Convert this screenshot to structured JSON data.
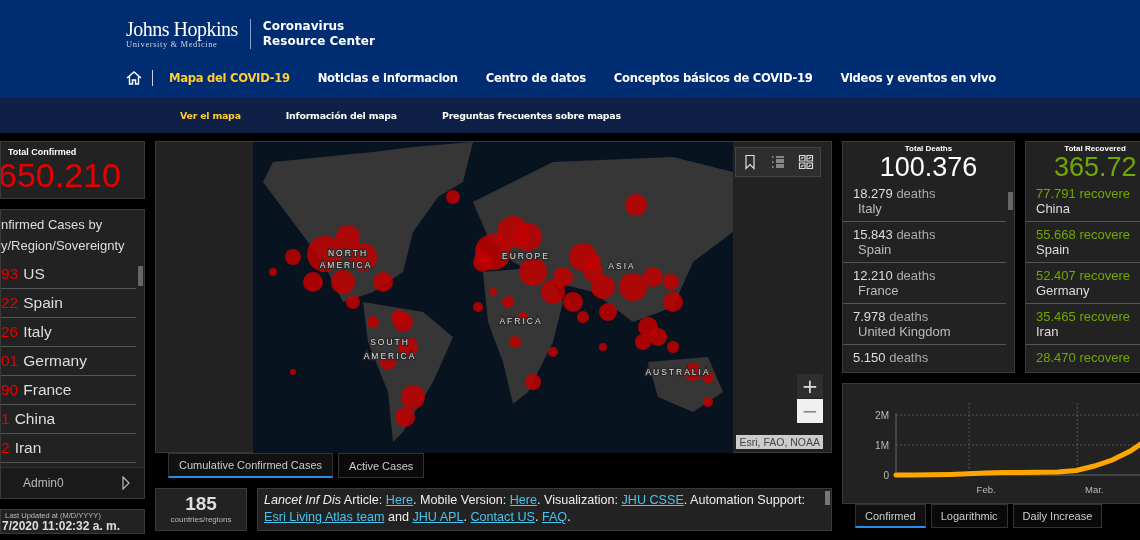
{
  "header": {
    "logo_name": "Johns Hopkins",
    "logo_sub": "University & Medicine",
    "site_title": [
      "Coronavirus",
      "Resource Center"
    ],
    "nav": [
      {
        "label": "Mapa del COVID-19",
        "selected": true
      },
      {
        "label": "Noticias e informacion",
        "selected": false
      },
      {
        "label": "Centro de datos",
        "selected": false
      },
      {
        "label": "Conceptos básicos de COVID-19",
        "selected": false
      },
      {
        "label": "Videos y eventos en vivo",
        "selected": false
      }
    ],
    "subnav": [
      {
        "label": "Ver el mapa",
        "selected": true
      },
      {
        "label": "Información del mapa",
        "selected": false
      },
      {
        "label": "Preguntas frecuentes sobre mapas",
        "selected": false
      }
    ]
  },
  "total_confirmed": {
    "label": "Total Confirmed",
    "value": "650.210"
  },
  "confirmed_list": {
    "title": [
      "nfirmed Cases by",
      "y/Region/Sovereignty"
    ],
    "rows": [
      {
        "count": "93",
        "name": "US"
      },
      {
        "count": "22",
        "name": "Spain"
      },
      {
        "count": "26",
        "name": "Italy"
      },
      {
        "count": "01",
        "name": "Germany"
      },
      {
        "count": "90",
        "name": "France"
      },
      {
        "count": "1",
        "name": "China"
      },
      {
        "count": "2",
        "name": "Iran"
      }
    ],
    "footer": "Admin0"
  },
  "last_updated": {
    "label": "Last Updated at (M/D/YYYY)",
    "value": "7/2020 11:02:32 a. m."
  },
  "map": {
    "region_labels": [
      "NORTH",
      "AMERICA",
      "EUROPE",
      "ASIA",
      "AFRICA",
      "SOUTH",
      "AMERICA",
      "AUSTRALIA"
    ],
    "attribution": "Esri, FAO, NOAA",
    "zoom_in": "+",
    "zoom_out": "−",
    "tabs": [
      {
        "label": "Cumulative Confirmed Cases",
        "selected": true
      },
      {
        "label": "Active Cases",
        "selected": false
      }
    ]
  },
  "countries": {
    "value": "185",
    "label": "countries/regions"
  },
  "info": [
    {
      "kind": "italic",
      "text": "Lancet Inf Dis"
    },
    {
      "kind": "plain",
      "text": " Article: "
    },
    {
      "kind": "link",
      "text": "Here"
    },
    {
      "kind": "plain",
      "text": ". Mobile Version: "
    },
    {
      "kind": "link",
      "text": "Here"
    },
    {
      "kind": "plain",
      "text": ". Visualization: "
    },
    {
      "kind": "link",
      "text": "JHU CSSE"
    },
    {
      "kind": "plain",
      "text": ". Automation Support: "
    },
    {
      "kind": "link",
      "text": "Esri Living Atlas team"
    },
    {
      "kind": "plain",
      "text": " and "
    },
    {
      "kind": "link",
      "text": "JHU APL"
    },
    {
      "kind": "plain",
      "text": ". "
    },
    {
      "kind": "link",
      "text": "Contact US"
    },
    {
      "kind": "plain",
      "text": ". "
    },
    {
      "kind": "link",
      "text": "FAQ"
    },
    {
      "kind": "plain",
      "text": "."
    }
  ],
  "deaths": {
    "label": "Total Deaths",
    "value": "100.376",
    "rows": [
      {
        "count": "18.279",
        "unit": "deaths",
        "place": "Italy"
      },
      {
        "count": "15.843",
        "unit": "deaths",
        "place": "Spain"
      },
      {
        "count": "12.210",
        "unit": "deaths",
        "place": "France"
      },
      {
        "count": "7.978",
        "unit": "deaths",
        "place": "United Kingdom"
      },
      {
        "count": "5.150",
        "unit": "deaths"
      }
    ]
  },
  "recovered": {
    "label": "Total Recovered",
    "value": "365.72",
    "rows": [
      {
        "count": "77.791",
        "unit": "recovere",
        "place": "China"
      },
      {
        "count": "55.668",
        "unit": "recovere",
        "place": "Spain"
      },
      {
        "count": "52.407",
        "unit": "recovere",
        "place": "Germany"
      },
      {
        "count": "35.465",
        "unit": "recovere",
        "place": "Iran"
      },
      {
        "count": "28.470",
        "unit": "recovere"
      }
    ]
  },
  "trend": {
    "chart_data": {
      "type": "line",
      "categories": [
        null,
        null,
        null,
        null,
        null,
        "Feb.",
        null,
        null,
        null,
        null,
        null,
        "Mar.",
        null,
        null,
        null
      ],
      "series": [
        {
          "color": "#ffa500",
          "values": [
            0,
            0,
            10000,
            20000,
            40000,
            70000,
            80000,
            80000,
            90000,
            100000,
            150000,
            300000,
            500000,
            800000,
            1200000
          ]
        }
      ],
      "ylim": [
        0,
        2400000
      ],
      "grid": true,
      "yticks": [
        {
          "value": 0,
          "label": "0"
        },
        {
          "value": 1000000,
          "label": "1M"
        },
        {
          "value": 2000000,
          "label": "2M"
        }
      ]
    },
    "tabs": [
      {
        "label": "Confirmed",
        "selected": true
      },
      {
        "label": "Logarithmic",
        "selected": false
      },
      {
        "label": "Daily Increase",
        "selected": false
      }
    ]
  }
}
